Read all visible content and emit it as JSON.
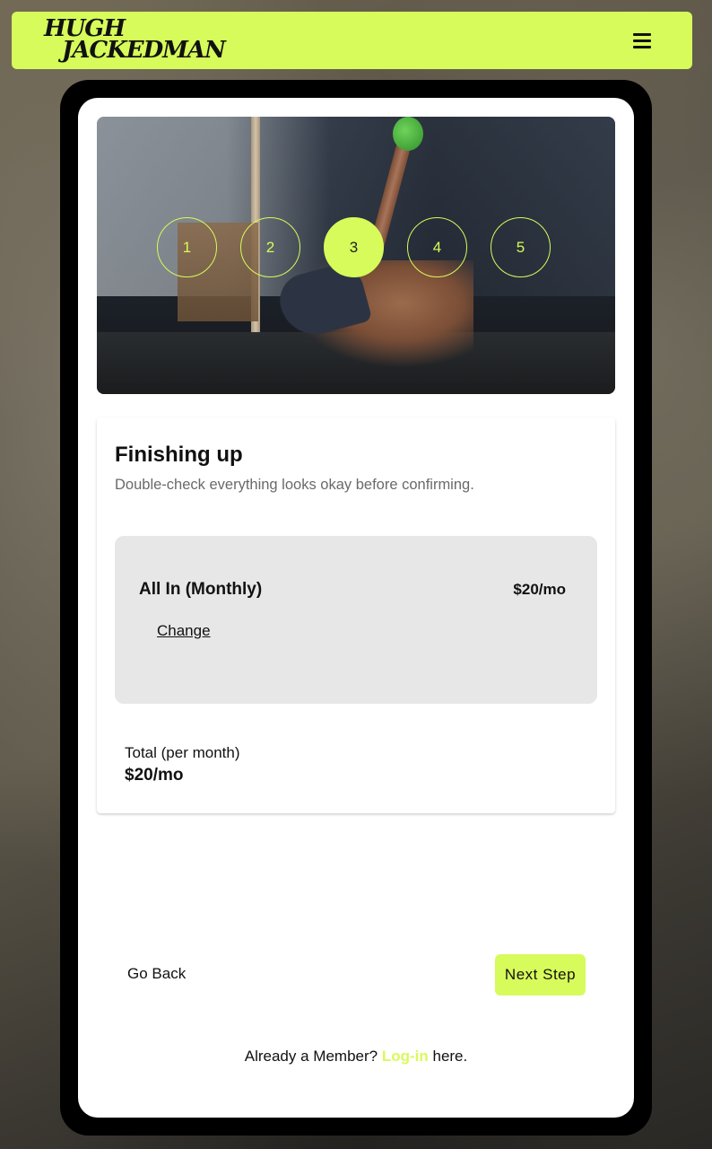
{
  "brand": {
    "logo_line1": "HUGH",
    "logo_line2": "JACKEDMAN",
    "accent_color": "#d7fb5a"
  },
  "header": {
    "menu_icon": "hamburger-menu-icon"
  },
  "steps": {
    "items": [
      "1",
      "2",
      "3",
      "4",
      "5"
    ],
    "active": "3"
  },
  "summary": {
    "title": "Finishing up",
    "subtitle": "Double-check everything looks okay before confirming.",
    "plan": {
      "name": "All In (Monthly)",
      "price": "$20/mo",
      "change_label": "Change"
    },
    "total_label": "Total (per month)",
    "total_value": "$20/mo"
  },
  "nav": {
    "back_label": "Go Back",
    "next_label": "Next Step"
  },
  "footer": {
    "prefix": "Already a Member?",
    "login_label": "Log-in",
    "suffix": "here."
  }
}
